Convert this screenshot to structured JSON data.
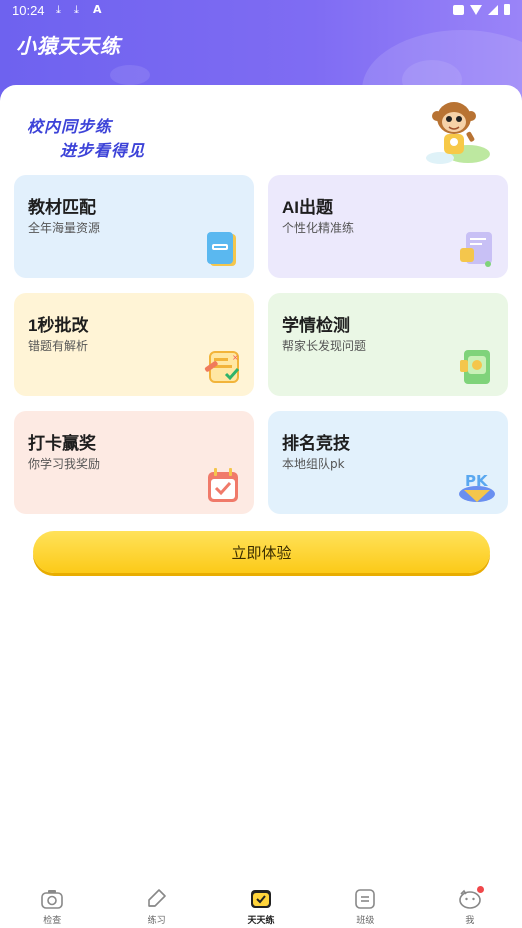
{
  "status_bar": {
    "time": "10:24",
    "download1": "⤓",
    "download2": "⤓",
    "a_icon": "A"
  },
  "app": {
    "title": "小猿天天练"
  },
  "slogan": {
    "line1": "校内同步练",
    "line2": "进步看得见"
  },
  "cards": [
    {
      "title": "教材匹配",
      "subtitle": "全年海量资源",
      "bg": "#e2f0fc",
      "icon": "textbook-icon"
    },
    {
      "title": "AI出题",
      "subtitle": "个性化精准练",
      "bg": "#ece9fc",
      "icon": "ai-paper-icon"
    },
    {
      "title": "1秒批改",
      "subtitle": "错题有解析",
      "bg": "#fff4d6",
      "icon": "grading-icon"
    },
    {
      "title": "学情检测",
      "subtitle": "帮家长发现问题",
      "bg": "#eaf7e5",
      "icon": "report-icon"
    },
    {
      "title": "打卡赢奖",
      "subtitle": "你学习我奖励",
      "bg": "#fdeae3",
      "icon": "checkin-calendar-icon"
    },
    {
      "title": "排名竞技",
      "subtitle": "本地组队pk",
      "bg": "#e2f1fc",
      "icon": "pk-icon"
    }
  ],
  "cta": {
    "label": "立即体验"
  },
  "tabs": [
    {
      "label": "检查",
      "icon": "camera-icon",
      "active": false
    },
    {
      "label": "练习",
      "icon": "pencil-icon",
      "active": false
    },
    {
      "label": "天天练",
      "icon": "daily-practice-icon",
      "active": true
    },
    {
      "label": "班级",
      "icon": "class-icon",
      "active": false
    },
    {
      "label": "我",
      "icon": "profile-icon",
      "active": false,
      "badge": true
    }
  ],
  "colors": {
    "header": "#7464f0",
    "accent_blue": "#3d43d8",
    "cta": "#fcca18",
    "badge": "#f0474a"
  }
}
